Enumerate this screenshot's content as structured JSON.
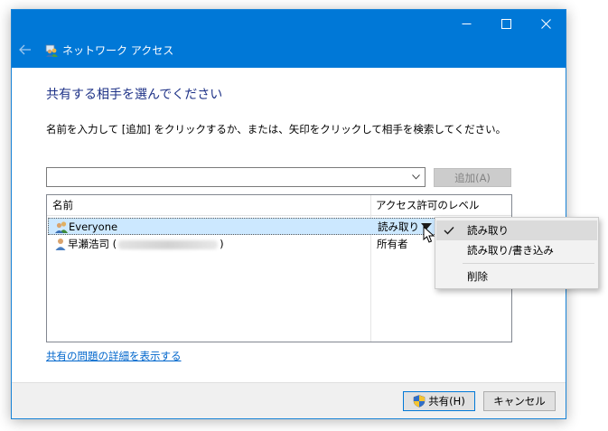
{
  "window": {
    "title": "ネットワーク アクセス",
    "accent_color": "#0078d7"
  },
  "icons": {
    "back": "back-arrow-icon",
    "title": "network-users-icon",
    "minimize": "minimize-icon",
    "maximize": "maximize-icon",
    "close": "close-icon",
    "combo_arrow": "chevron-down-icon",
    "everyone": "users-group-icon",
    "user": "user-icon",
    "permission_dropdown": "triangle-down-icon",
    "cursor": "mouse-pointer-icon",
    "check": "checkmark-icon",
    "shield": "uac-shield-icon"
  },
  "main": {
    "heading": "共有する相手を選んでください",
    "instruction": "名前を入力して [追加] をクリックするか、または、矢印をクリックして相手を検索してください。",
    "name_input_value": "",
    "add_button": "追加(A)"
  },
  "table": {
    "columns": [
      "名前",
      "アクセス許可のレベル"
    ],
    "rows": [
      {
        "name": "Everyone",
        "permission": "読み取り",
        "selected": true
      },
      {
        "name_prefix": "早瀬浩司 (",
        "name_suffix": ")",
        "permission": "所有者",
        "selected": false
      }
    ]
  },
  "context_menu": {
    "items": [
      {
        "label": "読み取り",
        "checked": true
      },
      {
        "label": "読み取り/書き込み",
        "checked": false
      },
      {
        "label": "削除",
        "checked": false
      }
    ]
  },
  "link": "共有の問題の詳細を表示する",
  "footer": {
    "share_button": "共有(H)",
    "cancel_button": "キャンセル"
  }
}
